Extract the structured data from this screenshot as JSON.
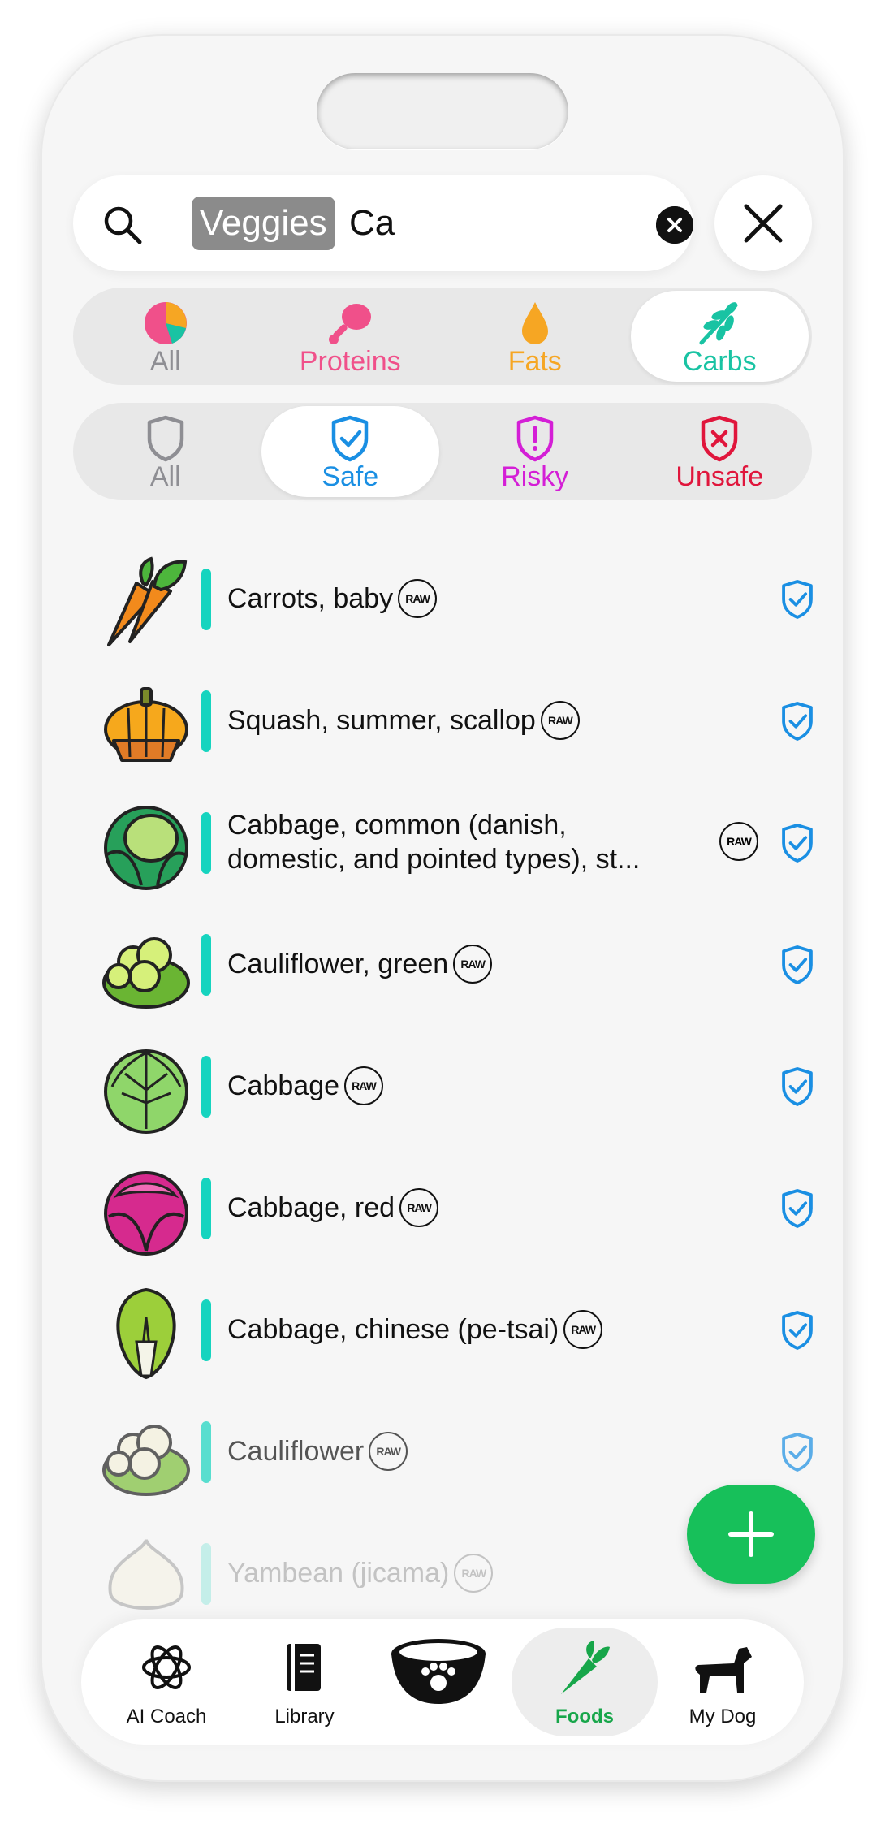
{
  "search": {
    "chip": "Veggies",
    "query": "Ca"
  },
  "macro_filter": {
    "options": [
      {
        "label": "All",
        "color": "#8e8e93",
        "icon": "pie-chart-icon"
      },
      {
        "label": "Proteins",
        "color": "#f0508a",
        "icon": "drumstick-icon"
      },
      {
        "label": "Fats",
        "color": "#f6a623",
        "icon": "drop-icon"
      },
      {
        "label": "Carbs",
        "color": "#19c3a3",
        "icon": "wheat-icon"
      }
    ],
    "selected": "Carbs"
  },
  "safety_filter": {
    "options": [
      {
        "label": "All",
        "color": "#8e8e93",
        "icon": "shield-outline-icon"
      },
      {
        "label": "Safe",
        "color": "#1a8fe3",
        "icon": "shield-check-icon"
      },
      {
        "label": "Risky",
        "color": "#d41fd6",
        "icon": "shield-exclaim-icon"
      },
      {
        "label": "Unsafe",
        "color": "#e0163c",
        "icon": "shield-x-icon"
      }
    ],
    "selected": "Safe"
  },
  "foods": [
    {
      "name": "Carrots, baby",
      "badge": "RAW",
      "status": "safe",
      "icon": "carrot-icon"
    },
    {
      "name": "Squash, summer, scallop",
      "badge": "RAW",
      "status": "safe",
      "icon": "squash-icon"
    },
    {
      "name": "Cabbage, common (danish, domestic, and pointed types), st...",
      "badge": "RAW",
      "status": "safe",
      "icon": "cabbage-icon"
    },
    {
      "name": "Cauliflower, green",
      "badge": "RAW",
      "status": "safe",
      "icon": "cauliflower-green-icon"
    },
    {
      "name": "Cabbage",
      "badge": "RAW",
      "status": "safe",
      "icon": "cabbage-light-icon"
    },
    {
      "name": "Cabbage, red",
      "badge": "RAW",
      "status": "safe",
      "icon": "red-cabbage-icon"
    },
    {
      "name": "Cabbage, chinese (pe-tsai)",
      "badge": "RAW",
      "status": "safe",
      "icon": "chinese-cabbage-icon"
    },
    {
      "name": "Cauliflower",
      "badge": "RAW",
      "status": "safe",
      "icon": "cauliflower-icon"
    },
    {
      "name": "Yambean (jicama)",
      "badge": "RAW",
      "status": "safe",
      "icon": "jicama-icon"
    }
  ],
  "tabs": [
    {
      "label": "AI Coach",
      "icon": "ai-coach-icon"
    },
    {
      "label": "Library",
      "icon": "book-icon"
    },
    {
      "label": "",
      "icon": "dog-bowl-icon"
    },
    {
      "label": "Foods",
      "icon": "carrot-tab-icon"
    },
    {
      "label": "My Dog",
      "icon": "dog-icon"
    }
  ],
  "selected_tab": "Foods",
  "colors": {
    "accent_green": "#17c05a",
    "bar_teal": "#16d4bf",
    "safe_blue": "#1a8fe3"
  }
}
